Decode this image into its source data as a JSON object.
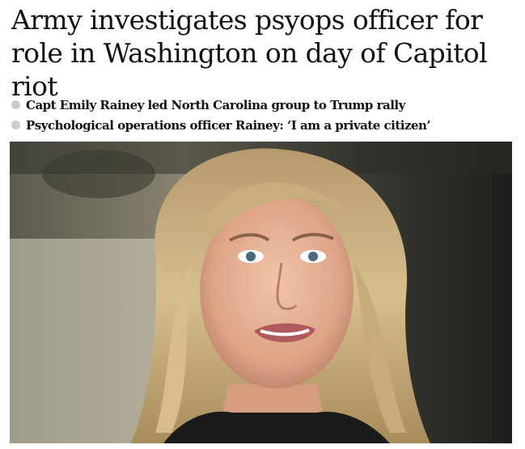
{
  "article": {
    "headline": "Army investigates psyops officer for role in Washington on day of Capitol riot",
    "bullets": [
      "Capt Emily Rainey led North Carolina group to Trump rally",
      "Psychological operations officer Rainey: ‘I am a private citizen’"
    ]
  },
  "icons": {
    "bullet": "bullet-dot-icon"
  },
  "colors": {
    "text": "#121212",
    "bullet_dot": "#cccccc",
    "background": "#ffffff"
  }
}
